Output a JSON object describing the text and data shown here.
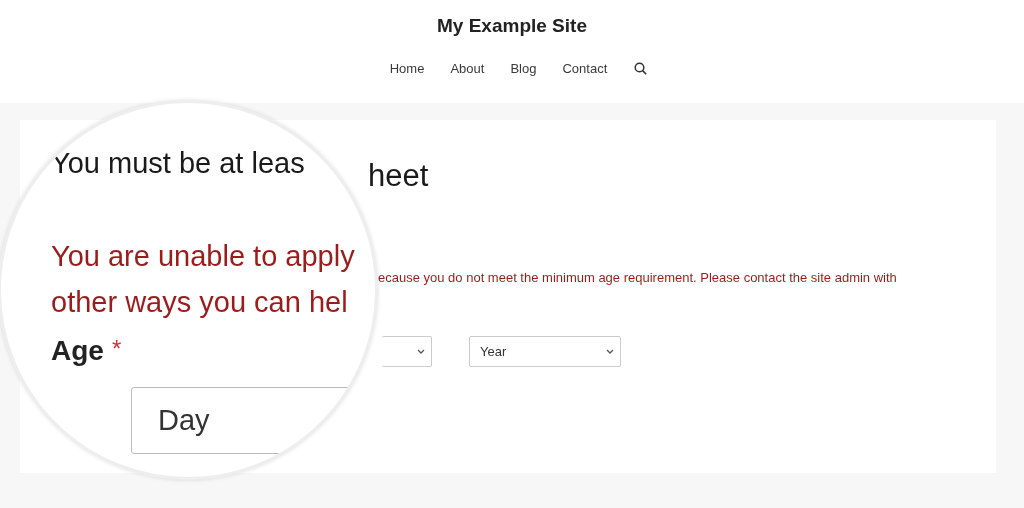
{
  "site": {
    "title": "My Example Site"
  },
  "nav": [
    "Home",
    "About",
    "Blog",
    "Contact"
  ],
  "form": {
    "title": "heet",
    "error": "ecause you do not meet the minimum age requirement. Please contact the site admin with",
    "year_select": {
      "value": "Year"
    }
  },
  "magnifier": {
    "title": "You must be at leas",
    "error_lines": [
      "You are unable to apply",
      "other ways you can hel"
    ],
    "label": "Age",
    "required_mark": "*",
    "day_select": {
      "value": "Day"
    }
  }
}
